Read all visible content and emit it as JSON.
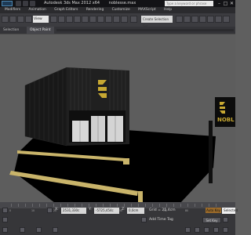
{
  "window": {
    "title": "Autodesk 3ds Max  2012 x64",
    "file": "noblesse.max",
    "search_placeholder": "Type a keyword or phrase"
  },
  "menu": [
    "Modifiers",
    "Animation",
    "Graph Editors",
    "Rendering",
    "Customize",
    "MAXScript",
    "Help"
  ],
  "toolbar": {
    "view_select": "View",
    "named_selection": "Create Selection Set"
  },
  "ribbon": {
    "tabs": [
      "Selection",
      "Object Paint"
    ]
  },
  "viewport": {
    "sign_text": "NOBL",
    "background": "#5d5d5d",
    "ground": "#000000",
    "building": "#1a1a1a",
    "curb": "#c9b46a",
    "logo": "#c7a832"
  },
  "status": {
    "ruler": [
      "0",
      "10",
      "20",
      "30",
      "40",
      "50",
      "60",
      "70",
      "80",
      "90",
      "100"
    ],
    "x_field": "2531,330c",
    "y_field": "-5725,454c",
    "z_field": "0,0cm",
    "grid": "Grid = 25,4cm",
    "add_time_tag": "Add Time Tag",
    "auto_key": "Auto Key",
    "set_key": "Set Key",
    "selected": "Selected"
  },
  "colors": {
    "titlebar": "#131316",
    "menubar": "#2b2b2e",
    "toolbar": "#3c3c40",
    "autokey": "#9a6a2a"
  }
}
